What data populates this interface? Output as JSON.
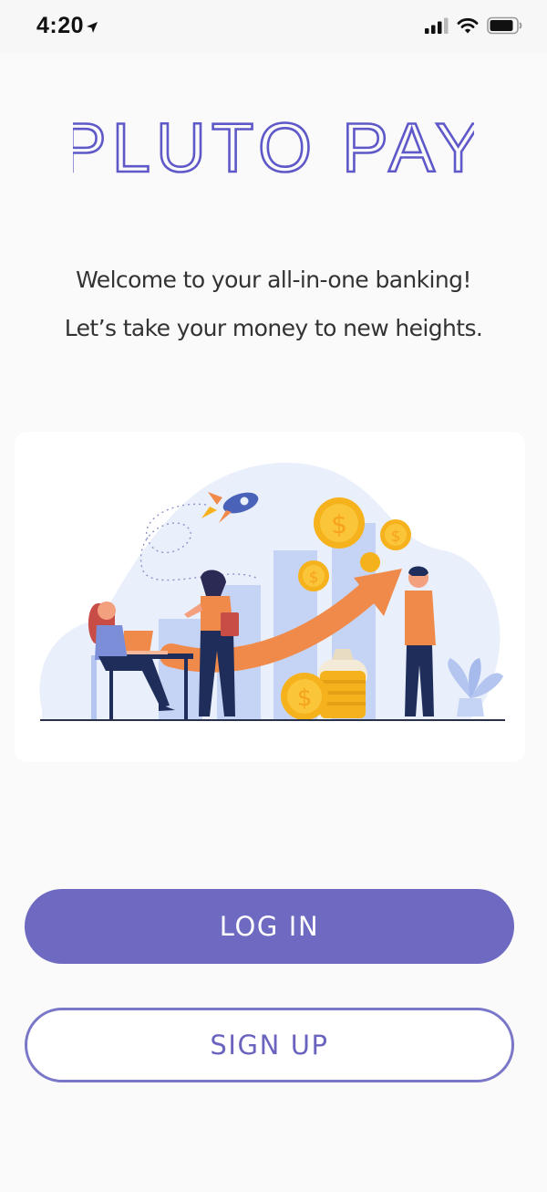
{
  "status_bar": {
    "time": "4:20"
  },
  "brand": {
    "name": "PLUTO PAY",
    "color": "#5e58c8"
  },
  "welcome": {
    "line1": "Welcome to your all-in-one banking!",
    "line2": "Let’s take your money to new heights."
  },
  "illustration": {
    "description_icon": "finance-growth-illustration"
  },
  "actions": {
    "login_label": "LOG IN",
    "signup_label": "SIGN UP"
  },
  "colors": {
    "primary": "#6e69c1",
    "outline": "#7a76c8",
    "coin": "#f6b21c",
    "arrow": "#f08a4b",
    "bars": "#c5d4f4"
  }
}
